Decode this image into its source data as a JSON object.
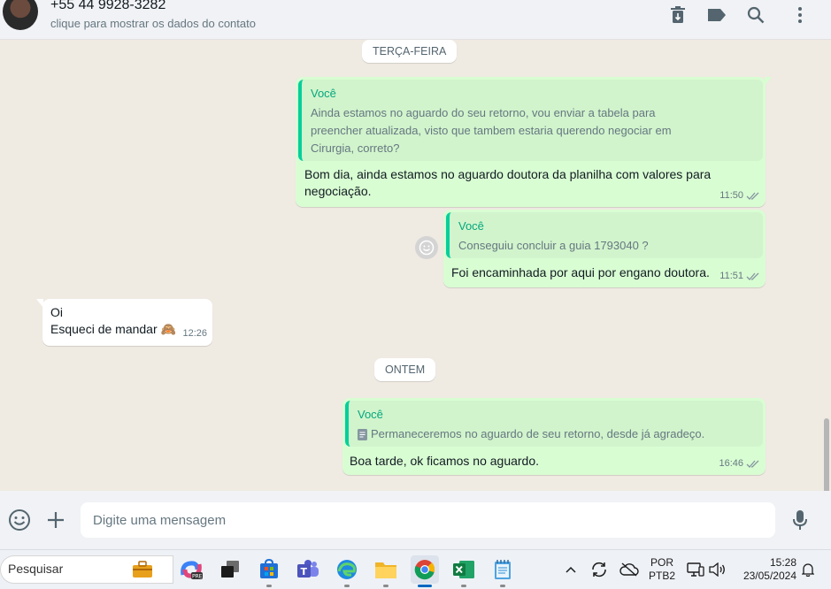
{
  "header": {
    "contact_name": "+55 44 9928-3282",
    "contact_subtitle": "clique para mostrar os dados do contato",
    "icons": [
      "delete-icon",
      "label-icon",
      "search-icon",
      "menu-icon"
    ]
  },
  "chat": {
    "dates": {
      "tuesday": "TERÇA-FEIRA",
      "yesterday": "ONTEM"
    },
    "messages": [
      {
        "direction": "outgoing",
        "quote_author": "Você",
        "quote_lines": [
          "Ainda estamos no aguardo do seu retorno, vou enviar a tabela para",
          "preencher atualizada, visto que tambem estaria querendo negociar em",
          "Cirurgia, correto?"
        ],
        "text_lines": [
          "Bom dia, ainda estamos no aguardo doutora da planilha com valores para",
          "negociação."
        ],
        "time": "11:50"
      },
      {
        "direction": "outgoing",
        "quote_author": "Você",
        "quote_text": "Conseguiu concluir a guia 1793040  ?",
        "text": "Foi encaminhada por aqui por engano doutora.",
        "time": "11:51"
      },
      {
        "direction": "incoming",
        "text_lines": [
          "Oi",
          "Esqueci de mandar 🙈"
        ],
        "time": "12:26"
      },
      {
        "direction": "outgoing",
        "quote_author": "Você",
        "quote_text": "Permaneceremos no aguardo de seu retorno, desde já agradeço.",
        "text": "Boa tarde, ok ficamos no aguardo.",
        "time": "16:46"
      }
    ]
  },
  "composer": {
    "placeholder": "Digite uma mensagem",
    "icons": [
      "emoji-icon",
      "plus-icon",
      "microphone-icon"
    ]
  },
  "taskbar": {
    "search_placeholder": "Pesquisar",
    "apps": [
      "work-icon",
      "copilot-icon",
      "task-view-icon",
      "store-icon",
      "teams-icon",
      "edge-icon",
      "file-explorer-icon",
      "chrome-icon",
      "excel-icon",
      "notepad-icon"
    ],
    "language": "POR",
    "keyboard": "PTB2",
    "time": "15:28",
    "date": "23/05/2024"
  },
  "colors": {
    "outgoing_bubble": "#d9fdd3",
    "incoming_bubble": "#ffffff",
    "quote_accent": "#06cf9c",
    "chat_background": "#efeae2"
  }
}
